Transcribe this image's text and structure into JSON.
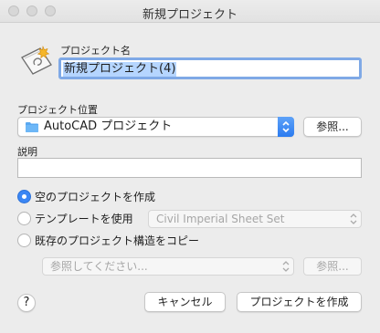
{
  "window": {
    "title": "新規プロジェクト"
  },
  "project_name": {
    "label": "プロジェクト名",
    "value": "新規プロジェクト(4)"
  },
  "location": {
    "label": "プロジェクト位置",
    "selected": "AutoCAD プロジェクト",
    "browse_label": "参照..."
  },
  "description": {
    "label": "説明",
    "value": ""
  },
  "options": {
    "blank": "空のプロジェクトを作成",
    "template": "テンプレートを使用",
    "template_selected": "Civil Imperial Sheet Set",
    "copy_existing": "既存のプロジェクト構造をコピー",
    "copy_placeholder": "参照してください...",
    "copy_browse_label": "参照...",
    "selected": "blank"
  },
  "footer": {
    "help": "?",
    "cancel_label": "キャンセル",
    "create_label": "プロジェクトを作成"
  },
  "icons": {
    "project": "project-sheet-icon",
    "folder": "folder-icon",
    "accent": "#3b86f4"
  }
}
